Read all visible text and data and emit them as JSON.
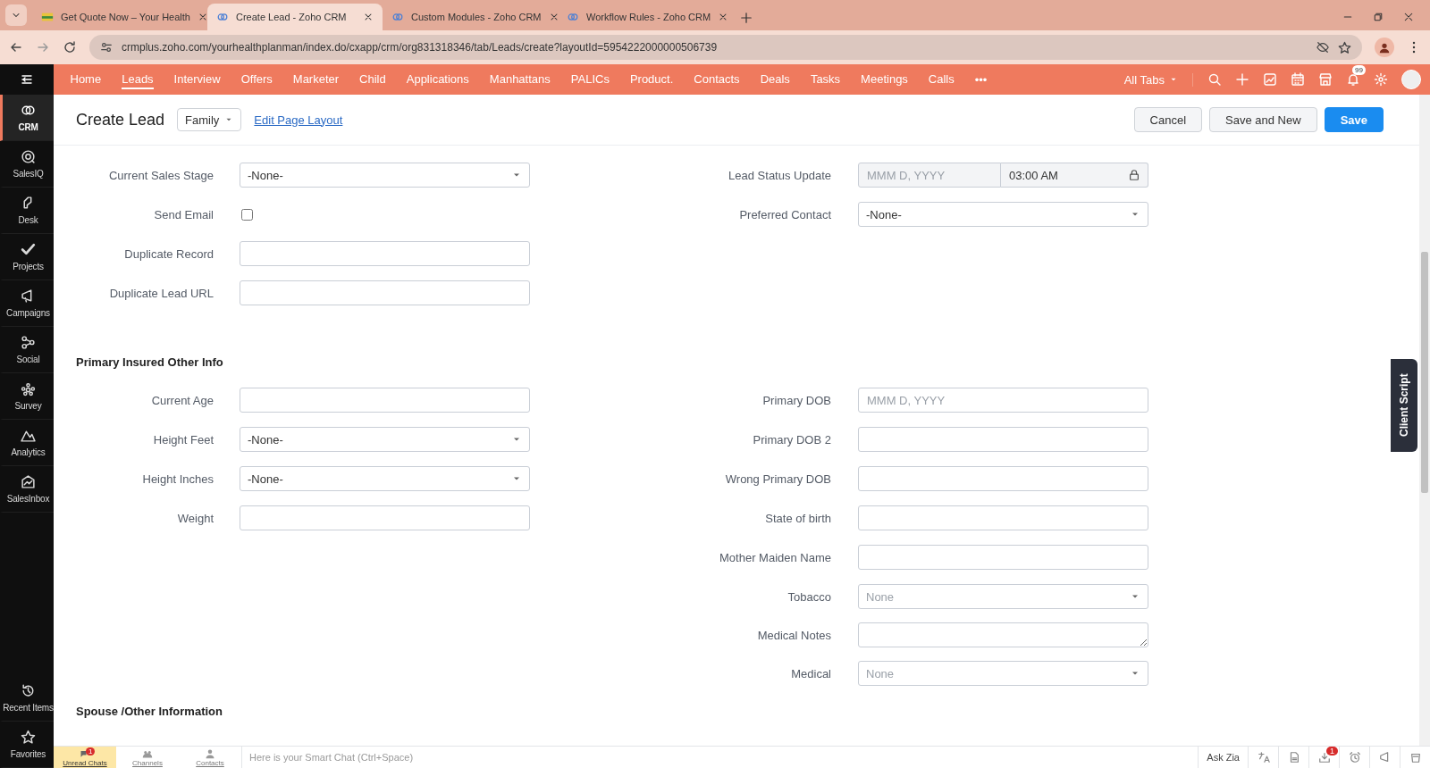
{
  "browser": {
    "tabs": [
      {
        "title": "Get Quote Now – Your Health",
        "selected": false
      },
      {
        "title": "Create Lead - Zoho CRM",
        "selected": true
      },
      {
        "title": "Custom Modules - Zoho CRM",
        "selected": false
      },
      {
        "title": "Workflow Rules - Zoho CRM",
        "selected": false
      }
    ],
    "url": "crmplus.zoho.com/yourhealthplanman/index.do/cxapp/crm/org831318346/tab/Leads/create?layoutId=5954222000000506739"
  },
  "nav": {
    "tabs": [
      {
        "label": "Home",
        "selected": false
      },
      {
        "label": "Leads",
        "selected": true
      },
      {
        "label": "Interview",
        "selected": false
      },
      {
        "label": "Offers",
        "selected": false
      },
      {
        "label": "Marketer",
        "selected": false
      },
      {
        "label": "Child",
        "selected": false
      },
      {
        "label": "Applications",
        "selected": false
      },
      {
        "label": "Manhattans",
        "selected": false
      },
      {
        "label": "PALICs",
        "selected": false
      },
      {
        "label": "Product.",
        "selected": false
      },
      {
        "label": "Contacts",
        "selected": false
      },
      {
        "label": "Deals",
        "selected": false
      },
      {
        "label": "Tasks",
        "selected": false
      },
      {
        "label": "Meetings",
        "selected": false
      },
      {
        "label": "Calls",
        "selected": false
      }
    ],
    "more": "•••",
    "all_tabs": "All Tabs",
    "notification_count": "99"
  },
  "sidebar": {
    "items": [
      {
        "label": "CRM",
        "selected": true
      },
      {
        "label": "SalesIQ",
        "selected": false
      },
      {
        "label": "Desk",
        "selected": false
      },
      {
        "label": "Projects",
        "selected": false
      },
      {
        "label": "Campaigns",
        "selected": false
      },
      {
        "label": "Social",
        "selected": false
      },
      {
        "label": "Survey",
        "selected": false
      },
      {
        "label": "Analytics",
        "selected": false
      },
      {
        "label": "SalesInbox",
        "selected": false
      }
    ],
    "bottom_items": [
      {
        "label": "Recent Items"
      },
      {
        "label": "Favorites"
      }
    ]
  },
  "header": {
    "title": "Create Lead",
    "layout": "Family",
    "edit_link": "Edit Page Layout",
    "buttons": [
      {
        "label": "Cancel",
        "kind": "secondary"
      },
      {
        "label": "Save and New",
        "kind": "secondary"
      },
      {
        "label": "Save",
        "kind": "primary"
      }
    ]
  },
  "sections": [
    {
      "left": [
        {
          "label": "Current Sales Stage",
          "kind": "select",
          "value": "-None-"
        },
        {
          "label": "Send Email",
          "kind": "checkbox",
          "checked": false
        },
        {
          "label": "Duplicate Record",
          "kind": "text"
        },
        {
          "label": "Duplicate Lead URL",
          "kind": "text"
        }
      ],
      "right": [
        {
          "label": "Lead Status Update",
          "kind": "datetime",
          "placeholder": "MMM D, YYYY",
          "value": "03:00 AM"
        },
        {
          "label": "Preferred Contact",
          "kind": "select",
          "value": "-None-"
        }
      ]
    },
    {
      "title": "Primary Insured Other Info",
      "left": [
        {
          "label": "Current Age",
          "kind": "text"
        },
        {
          "label": "Height Feet",
          "kind": "select",
          "value": "-None-"
        },
        {
          "label": "Height Inches",
          "kind": "select",
          "value": "-None-"
        },
        {
          "label": "Weight",
          "kind": "text"
        }
      ],
      "right": [
        {
          "label": "Primary DOB",
          "kind": "text",
          "placeholder": "MMM D, YYYY"
        },
        {
          "label": "Primary DOB 2",
          "kind": "text"
        },
        {
          "label": "Wrong Primary DOB",
          "kind": "text"
        },
        {
          "label": "State of birth",
          "kind": "text"
        },
        {
          "label": "Mother Maiden Name",
          "kind": "text"
        },
        {
          "label": "Tobacco",
          "kind": "select",
          "placeholder": "None"
        },
        {
          "label": "Medical Notes",
          "kind": "textarea"
        },
        {
          "label": "Medical",
          "kind": "select",
          "placeholder": "None"
        }
      ]
    },
    {
      "title": "Spouse /Other Information"
    }
  ],
  "client_script": "Client Script",
  "bottom_bar": {
    "tabs": [
      {
        "label": "Unread Chats",
        "selected": true,
        "badge": "1"
      },
      {
        "label": "Channels",
        "selected": false
      },
      {
        "label": "Contacts",
        "selected": false
      }
    ],
    "chat_placeholder": "Here is your Smart Chat (Ctrl+Space)",
    "ask_zia": "Ask Zia",
    "tray_badge": "1"
  }
}
